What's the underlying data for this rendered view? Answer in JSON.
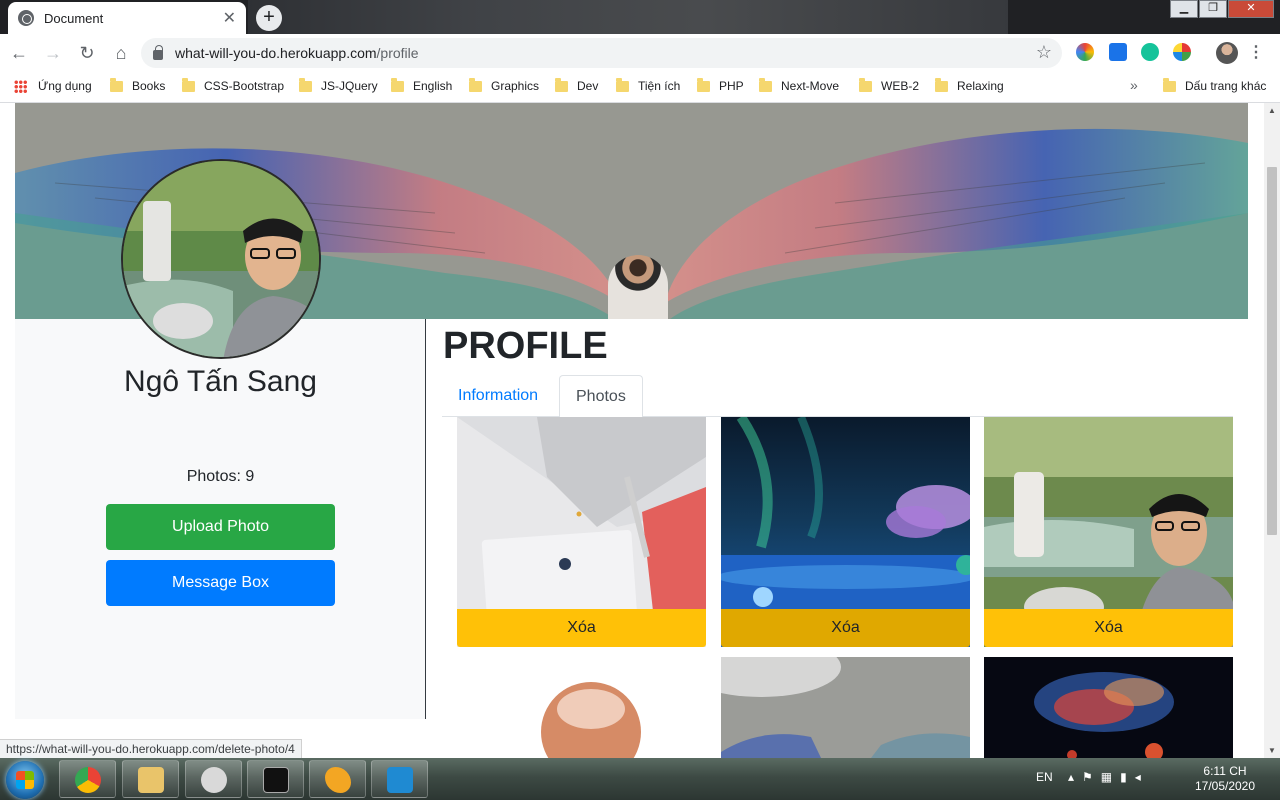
{
  "browser": {
    "tab_title": "Document",
    "url_host": "what-will-you-do.herokuapp.com",
    "url_path": "/profile",
    "status_url": "https://what-will-you-do.herokuapp.com/delete-photo/4",
    "bookmarks": [
      "Ứng dụng",
      "Books",
      "CSS-Bootstrap",
      "JS-JQuery",
      "English",
      "Graphics",
      "Dev",
      "Tiện ích",
      "PHP",
      "Next-Move",
      "WEB-2",
      "Relaxing"
    ],
    "other_bookmarks": "Dấu trang khác"
  },
  "profile": {
    "name": "Ngô Tấn Sang",
    "photos_count": "Photos: 9",
    "upload_label": "Upload Photo",
    "message_label": "Message Box"
  },
  "main": {
    "title": "PROFILE",
    "tabs": [
      {
        "label": "Information",
        "active": false
      },
      {
        "label": "Photos",
        "active": true
      }
    ],
    "delete_label": "Xóa"
  },
  "taskbar": {
    "lang": "EN",
    "time": "6:11 CH",
    "date": "17/05/2020"
  },
  "colors": {
    "upload": "#28a745",
    "message": "#007bff",
    "delete": "#ffc107",
    "link": "#007bff"
  }
}
